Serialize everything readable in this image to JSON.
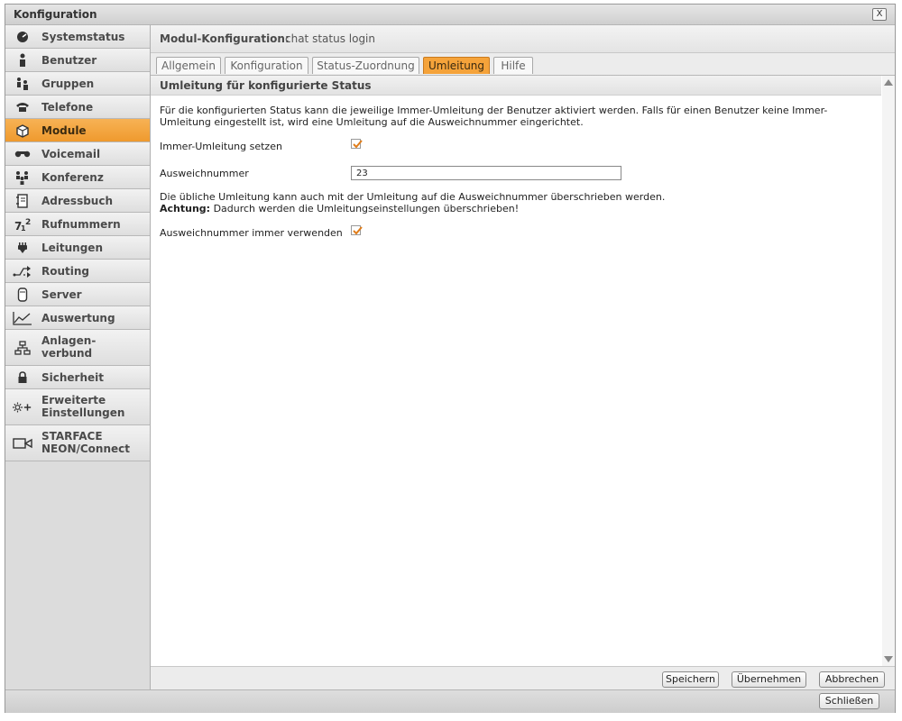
{
  "window": {
    "title": "Konfiguration",
    "close_label": "X"
  },
  "sidebar": {
    "items": [
      {
        "label": "Systemstatus",
        "icon": "gauge-icon"
      },
      {
        "label": "Benutzer",
        "icon": "user-icon"
      },
      {
        "label": "Gruppen",
        "icon": "group-icon"
      },
      {
        "label": "Telefone",
        "icon": "phone-icon"
      },
      {
        "label": "Module",
        "icon": "cube-icon",
        "active": true
      },
      {
        "label": "Voicemail",
        "icon": "voicemail-icon"
      },
      {
        "label": "Konferenz",
        "icon": "conference-icon"
      },
      {
        "label": "Adressbuch",
        "icon": "addressbook-icon"
      },
      {
        "label": "Rufnummern",
        "icon": "numbers-icon"
      },
      {
        "label": "Leitungen",
        "icon": "plug-icon"
      },
      {
        "label": "Routing",
        "icon": "routing-icon"
      },
      {
        "label": "Server",
        "icon": "server-icon"
      },
      {
        "label": "Auswertung",
        "icon": "chart-icon"
      },
      {
        "label": "Anlagen- verbund",
        "icon": "network-icon"
      },
      {
        "label": "Sicherheit",
        "icon": "lock-icon"
      },
      {
        "label": "Erweiterte Einstellungen",
        "icon": "settings-plus-icon"
      },
      {
        "label": "STARFACE NEON/Connect",
        "icon": "camera-icon"
      }
    ]
  },
  "main": {
    "header_key": "Modul-Konfiguration:",
    "header_value": "chat status login",
    "tabs": [
      {
        "label": "Allgemein"
      },
      {
        "label": "Konfiguration"
      },
      {
        "label": "Status-Zuordnung"
      },
      {
        "label": "Umleitung",
        "active": true
      },
      {
        "label": "Hilfe"
      }
    ],
    "section_title": "Umleitung für konfigurierte Status",
    "intro_text": "Für die konfigurierten Status kann die jeweilige Immer-Umleitung der Benutzer aktiviert werden. Falls für einen Benutzer keine Immer-Umleitung eingestellt ist, wird eine Umleitung auf die Ausweichnummer eingerichtet.",
    "field_immer_label": "Immer-Umleitung setzen",
    "field_immer_checked": true,
    "field_ausweich_label": "Ausweichnummer",
    "field_ausweich_value": "23",
    "note_text": "Die übliche Umleitung kann auch mit der Umleitung auf die Ausweichnummer überschrieben werden.",
    "warning_bold": "Achtung:",
    "warning_text": "Dadurch werden die Umleitungseinstellungen überschrieben!",
    "field_always_label": "Ausweichnummer immer verwenden",
    "field_always_checked": true
  },
  "buttons": {
    "save": "Speichern",
    "apply": "Übernehmen",
    "cancel": "Abbrechen",
    "close": "Schließen"
  },
  "colors": {
    "accent": "#f5a33a",
    "checkmark": "#e07d1a"
  }
}
